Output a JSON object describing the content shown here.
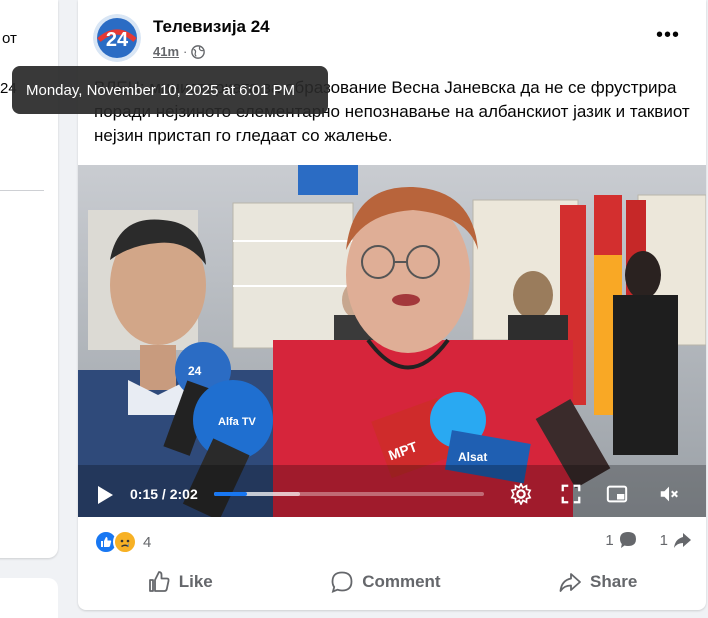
{
  "left_feed": {
    "fragment_1": "от",
    "fragment_2": "24"
  },
  "post": {
    "page_name": "Телевизија 24",
    "time": "41m",
    "privacy_icon": "globe-icon",
    "more_icon": "more-options-icon",
    "more_label": "•••",
    "text": "ВЛЕН: министерката за образование Весна Јаневска да не се фрустрира поради нејзиното елементарно непознавање на албанскиот јазик и таквиот нејзин пристап го гледаат со жалење.",
    "avatar_text": "24"
  },
  "tooltip": {
    "text": "Monday, November 10, 2025 at 6:01 PM"
  },
  "video": {
    "current_time": "0:15",
    "separator": " / ",
    "duration": "2:02",
    "progress_fraction": 0.123,
    "buffered_fraction": 0.32,
    "mic_label_1": "МРТ",
    "mic_label_2": "Alsat",
    "mic_label_3": "Alfa TV",
    "mic_label_4": "24"
  },
  "reactions": {
    "count": "4",
    "types": [
      "like",
      "sad"
    ]
  },
  "counts": {
    "comments": "1",
    "shares": "1"
  },
  "actions": {
    "like": "Like",
    "comment": "Comment",
    "share": "Share"
  },
  "colors": {
    "brand_blue": "#1877f2",
    "text_secondary": "#65676b",
    "background": "#f0f2f5"
  }
}
